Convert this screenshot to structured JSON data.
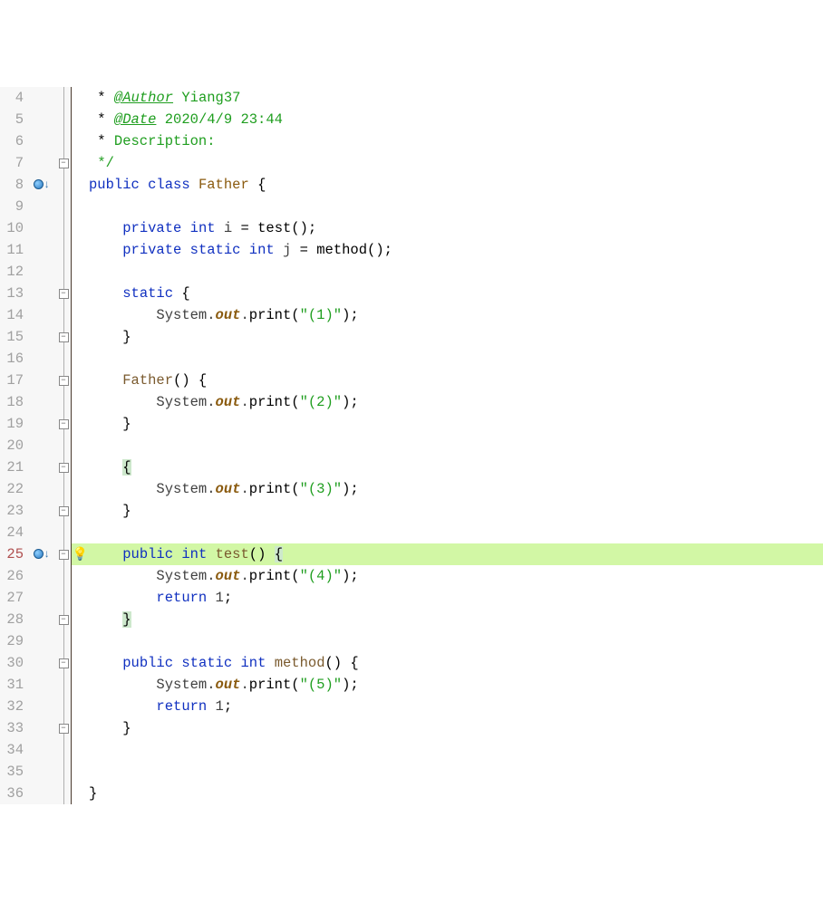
{
  "lines": [
    {
      "n": 4,
      "fold": "line",
      "html": " * <span class='t-doctag'>@Author</span> <span class='t-doc'>Yiang37</span>"
    },
    {
      "n": 5,
      "fold": "line",
      "html": " * <span class='t-doctag'>@Date</span> <span class='t-doc'>2020/4/9 23:44</span>"
    },
    {
      "n": 6,
      "fold": "line",
      "html": " * <span class='t-doc'>Description:</span>"
    },
    {
      "n": 7,
      "fold": "close",
      "html": " <span class='t-doc'>*/</span>"
    },
    {
      "n": 8,
      "mark": "bp",
      "fold": "line",
      "html": "<span class='t-kw'>public</span> <span class='t-kw'>class</span> <span class='t-classname'>Father</span> {"
    },
    {
      "n": 9,
      "fold": "line",
      "html": ""
    },
    {
      "n": 10,
      "fold": "line",
      "html": "    <span class='t-kw'>private</span> <span class='t-kw'>int</span> <span class='t-var'>i</span> = test();"
    },
    {
      "n": 11,
      "fold": "line",
      "html": "    <span class='t-kw'>private</span> <span class='t-kw'>static</span> <span class='t-kw'>int</span> <span class='t-var'>j</span> = method();"
    },
    {
      "n": 12,
      "fold": "line",
      "html": ""
    },
    {
      "n": 13,
      "fold": "open",
      "html": "    <span class='t-kw'>static</span> {"
    },
    {
      "n": 14,
      "fold": "line",
      "html": "        <span class='t-sys'>System</span><span class='t-dot'>.</span><span class='t-out'>out</span><span class='t-dot'>.</span>print(<span class='t-string'>\"(1)\"</span>);"
    },
    {
      "n": 15,
      "fold": "close",
      "html": "    }"
    },
    {
      "n": 16,
      "fold": "line",
      "html": ""
    },
    {
      "n": 17,
      "fold": "open",
      "html": "    <span class='t-method'>Father</span>() {"
    },
    {
      "n": 18,
      "fold": "line",
      "html": "        <span class='t-sys'>System</span><span class='t-dot'>.</span><span class='t-out'>out</span><span class='t-dot'>.</span>print(<span class='t-string'>\"(2)\"</span>);"
    },
    {
      "n": 19,
      "fold": "close",
      "html": "    }"
    },
    {
      "n": 20,
      "fold": "line",
      "html": ""
    },
    {
      "n": 21,
      "fold": "open",
      "html": "    <span class='brace-hi'>{</span>"
    },
    {
      "n": 22,
      "fold": "line",
      "html": "        <span class='t-sys'>System</span><span class='t-dot'>.</span><span class='t-out'>out</span><span class='t-dot'>.</span>print(<span class='t-string'>\"(3)\"</span>);"
    },
    {
      "n": 23,
      "fold": "close",
      "html": "    }"
    },
    {
      "n": 24,
      "fold": "line",
      "html": ""
    },
    {
      "n": 25,
      "mark": "bp",
      "fold": "open",
      "bulb": true,
      "hl": true,
      "html": "    <span class='t-kw'>public</span> <span class='t-kw'>int</span> <span class='t-method'>test</span>() <span class='brace-hi'>{</span>"
    },
    {
      "n": 26,
      "fold": "line",
      "html": "        <span class='t-sys'>System</span><span class='t-dot'>.</span><span class='t-out'>out</span><span class='t-dot'>.</span>print(<span class='t-string'>\"(4)\"</span>);"
    },
    {
      "n": 27,
      "fold": "line",
      "html": "        <span class='t-kw'>return</span> <span class='t-var'>1</span>;"
    },
    {
      "n": 28,
      "fold": "close",
      "html": "    <span class='brace-hi'>}</span>"
    },
    {
      "n": 29,
      "fold": "line",
      "html": ""
    },
    {
      "n": 30,
      "fold": "open",
      "html": "    <span class='t-kw'>public</span> <span class='t-kw'>static</span> <span class='t-kw'>int</span> <span class='t-method'>method</span>() {"
    },
    {
      "n": 31,
      "fold": "line",
      "html": "        <span class='t-sys'>System</span><span class='t-dot'>.</span><span class='t-out'>out</span><span class='t-dot'>.</span>print(<span class='t-string'>\"(5)\"</span>);"
    },
    {
      "n": 32,
      "fold": "line",
      "html": "        <span class='t-kw'>return</span> <span class='t-var'>1</span>;"
    },
    {
      "n": 33,
      "fold": "close",
      "html": "    }"
    },
    {
      "n": 34,
      "fold": "line",
      "html": ""
    },
    {
      "n": 35,
      "fold": "line",
      "html": ""
    },
    {
      "n": 36,
      "fold": "line",
      "html": "}"
    }
  ],
  "glyphs": {
    "fold_open": "⊟",
    "fold_close": "⊟",
    "bulb": "💡",
    "arrow": "↓"
  }
}
